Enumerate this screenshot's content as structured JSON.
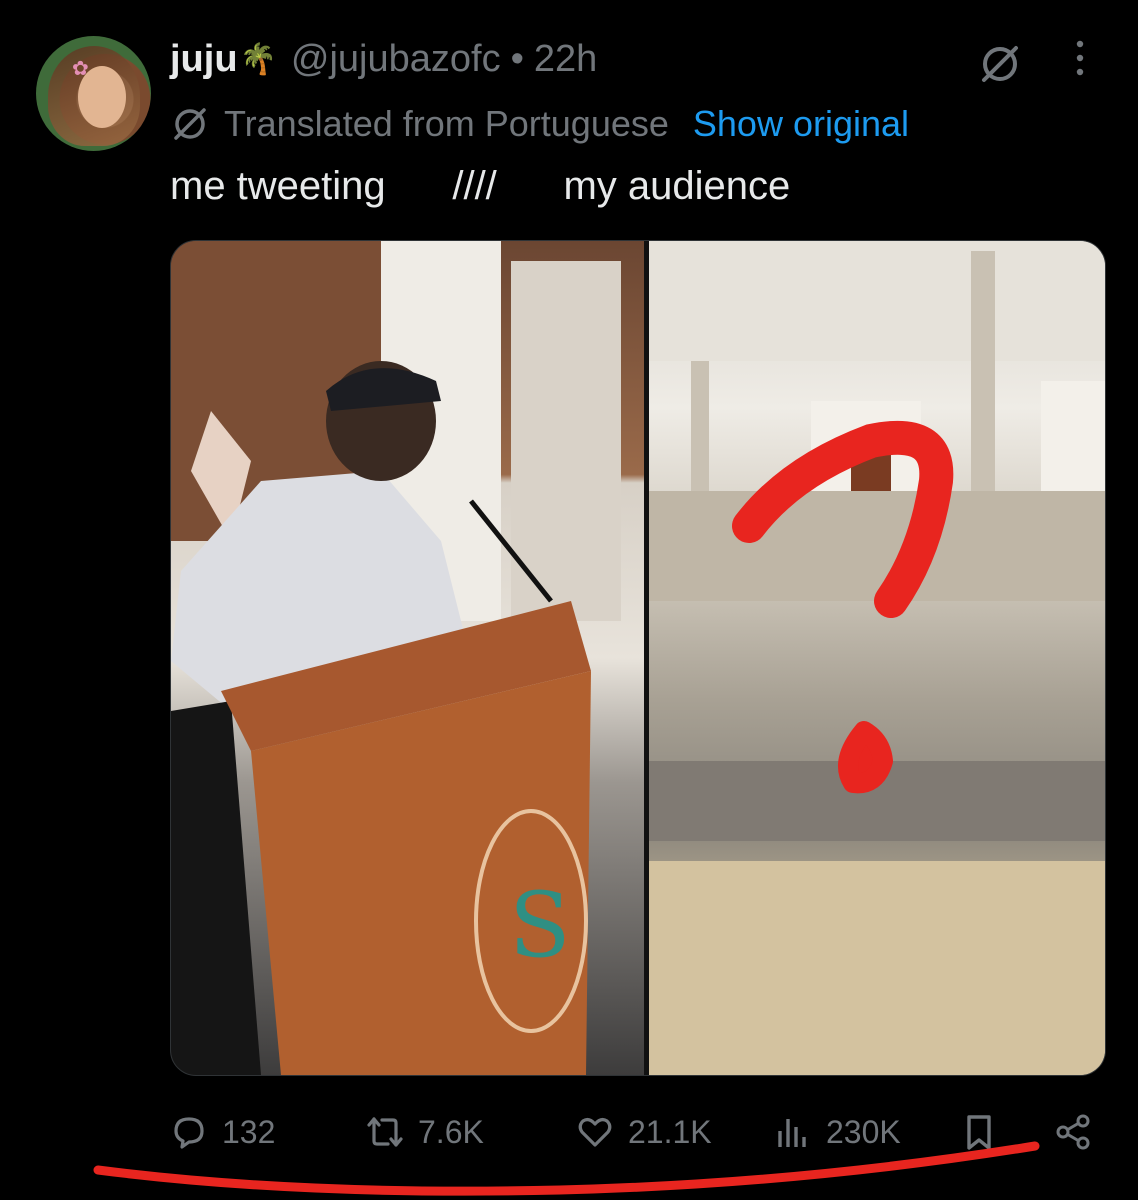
{
  "tweet": {
    "author_name": "juju",
    "author_emoji": "🌴",
    "handle": "@jujubazofc",
    "separator": "•",
    "time": "22h",
    "translated_label": "Translated from Portuguese",
    "show_original": "Show original",
    "text": "me tweeting      ////      my audience"
  },
  "stats": {
    "replies": "132",
    "reposts": "7.6K",
    "likes": "21.1K",
    "views": "230K"
  },
  "icons": {
    "grok": "grok-icon",
    "more": "more-dots-icon",
    "translate": "translate-icon",
    "reply": "reply-icon",
    "repost": "repost-icon",
    "like": "heart-icon",
    "views": "views-icon",
    "bookmark": "bookmark-icon",
    "share": "share-icon"
  },
  "colors": {
    "background": "#000000",
    "text": "#e7e9ea",
    "muted": "#71767b",
    "link": "#1d9bf0",
    "annotation_red": "#e8251f"
  }
}
